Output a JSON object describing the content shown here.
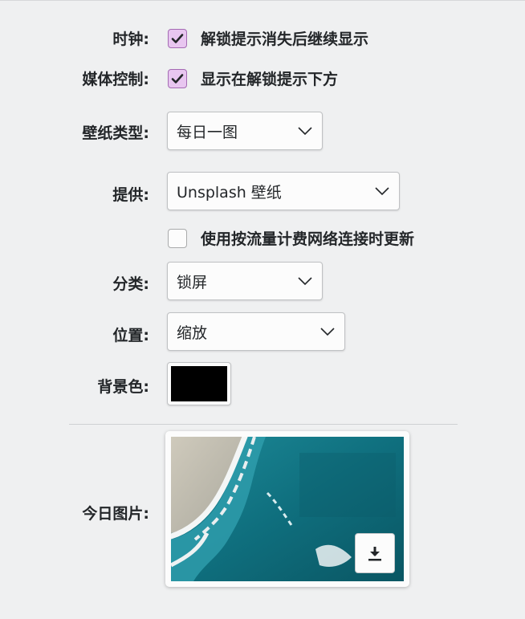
{
  "clock": {
    "label": "时钟:",
    "option_text": "解锁提示消失后继续显示",
    "checked": true
  },
  "media": {
    "label": "媒体控制:",
    "option_text": "显示在解锁提示下方",
    "checked": true
  },
  "wallpaper_type": {
    "label": "壁纸类型:",
    "value": "每日一图"
  },
  "provider": {
    "label": "提供:",
    "value": "Unsplash 壁纸"
  },
  "metered": {
    "option_text": "使用按流量计费网络连接时更新",
    "checked": false
  },
  "category": {
    "label": "分类:",
    "value": "锁屏"
  },
  "position": {
    "label": "位置:",
    "value": "缩放"
  },
  "background_color": {
    "label": "背景色:",
    "value": "#000000"
  },
  "today_image": {
    "label": "今日图片:"
  },
  "colors": {
    "accent": "#a46ab3",
    "check_fill": "#e8c6f0"
  },
  "icons": {
    "check": "check-icon",
    "chevron": "chevron-down-icon",
    "download": "download-icon"
  }
}
